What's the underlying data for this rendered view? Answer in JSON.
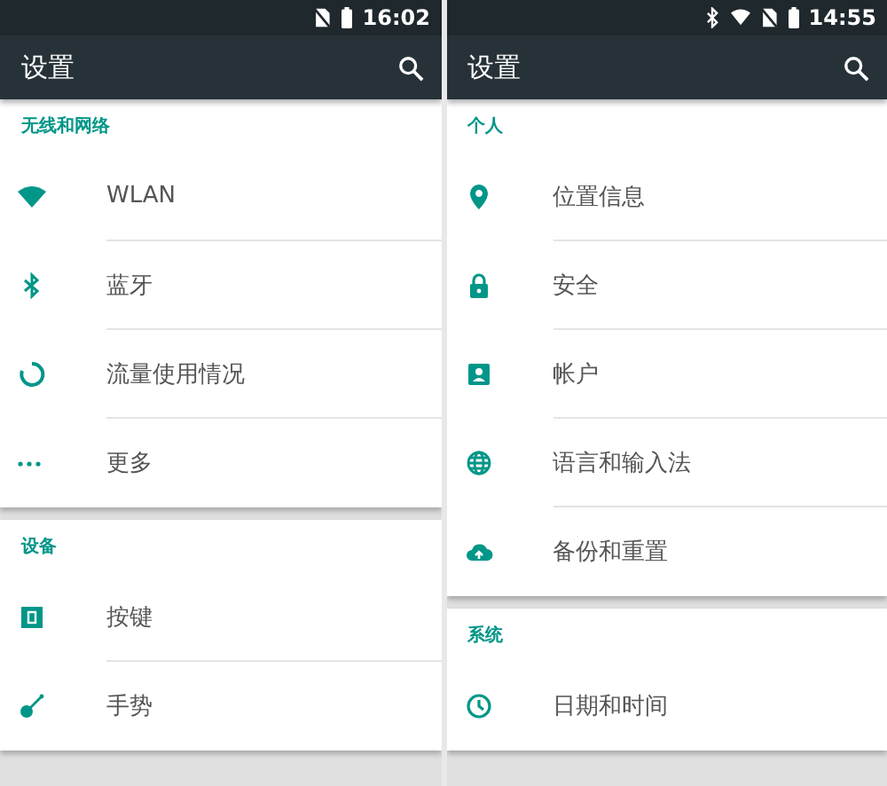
{
  "screens": [
    {
      "status_bar": {
        "time": "16:02"
      },
      "title": "设置",
      "sections": [
        {
          "header": "无线和网络",
          "items": [
            {
              "label": "WLAN"
            },
            {
              "label": "蓝牙"
            },
            {
              "label": "流量使用情况"
            },
            {
              "label": "更多"
            }
          ]
        },
        {
          "header": "设备",
          "items": [
            {
              "label": "按键"
            },
            {
              "label": "手势"
            }
          ]
        }
      ]
    },
    {
      "status_bar": {
        "time": "14:55"
      },
      "title": "设置",
      "sections": [
        {
          "header": "个人",
          "items": [
            {
              "label": "位置信息"
            },
            {
              "label": "安全"
            },
            {
              "label": "帐户"
            },
            {
              "label": "语言和输入法"
            },
            {
              "label": "备份和重置"
            }
          ]
        },
        {
          "header": "系统",
          "items": [
            {
              "label": "日期和时间"
            }
          ]
        }
      ]
    }
  ]
}
